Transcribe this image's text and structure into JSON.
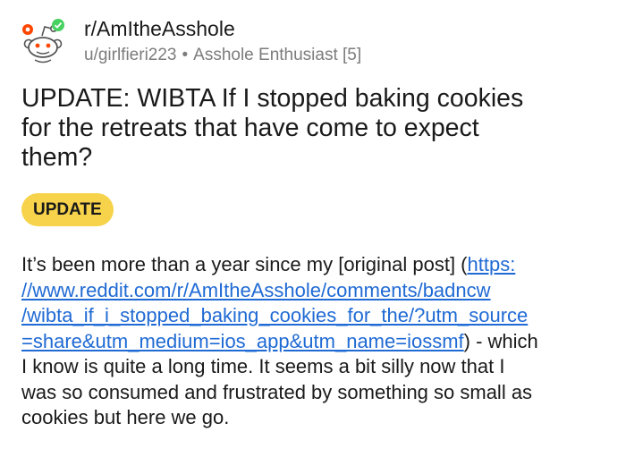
{
  "post": {
    "subreddit": "r/AmItheAsshole",
    "author": "u/girlfieri223",
    "separator": "•",
    "user_flair": "Asshole Enthusiast [5]",
    "title_lines": [
      "UPDATE: WIBTA If I stopped baking cookies",
      "for the retreats that have come to expect",
      "them?"
    ],
    "flair": "UPDATE",
    "body": {
      "line1_text": "It’s been more than a year since my [original post] (",
      "link_lines": [
        "https:",
        "//www.reddit.com/r/AmItheAsshole/comments/badncw",
        "/wibta_if_i_stopped_baking_cookies_for_the/?utm_source",
        "=share&utm_medium=ios_app&utm_name=iossmf"
      ],
      "line4_after_link": ") - which",
      "lines_rest": [
        "I know is quite a long time. It seems a bit silly now that I",
        "was so consumed and frustrated by something so small as",
        "cookies but here we go."
      ]
    }
  },
  "colors": {
    "flair_bg": "#f6d34a",
    "link": "#1f6ad4",
    "meta_text": "#7c7c7c",
    "snoo_orange": "#ff4500",
    "badge_green": "#46d160"
  },
  "icons": {
    "avatar": "snoo-icon",
    "badge": "check-badge-icon"
  }
}
